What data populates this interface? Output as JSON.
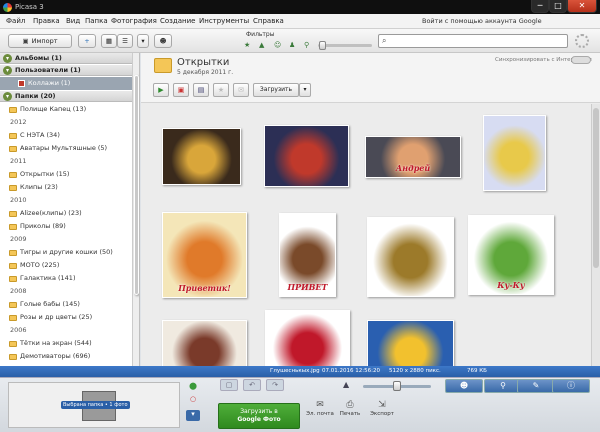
{
  "window": {
    "title": "Picasa 3"
  },
  "window_buttons": {
    "minimize": "─",
    "maximize": "□",
    "close": "✕"
  },
  "menu": {
    "items": [
      "Файл",
      "Правка",
      "Вид",
      "Папка",
      "Фотография",
      "Создание",
      "Инструменты",
      "Справка"
    ],
    "signin_link": "Войти с помощью аккаунта Google"
  },
  "toolbar": {
    "import_label": "Импорт",
    "import_icon": "camera-icon",
    "filters_label": "Фильтры",
    "filter_icons": [
      "star",
      "upload",
      "face",
      "people",
      "pin"
    ],
    "filter_glyphs": [
      "★",
      "▲",
      "☺",
      "♟",
      "⚲"
    ],
    "search_value": "",
    "search_glyph": "⌕",
    "album_glyph": "+",
    "view_thumb_glyph": "▦",
    "view_list_glyph": "☰",
    "dropdown_glyph": "▾",
    "people_glyph": "☻"
  },
  "sidebar": {
    "albums_header": "Альбомы (1)",
    "users_header": "Пользователи (1)",
    "collage_item": "Коллажи (1)",
    "folders_header": "Папки (20)",
    "toggle_glyph": "▾",
    "rows": [
      {
        "type": "folder",
        "label": "Полище Капец (13)"
      },
      {
        "type": "year",
        "label": "2012"
      },
      {
        "type": "folder",
        "label": "С НЭТА (34)"
      },
      {
        "type": "folder",
        "label": "Аватары Мультяшные (5)"
      },
      {
        "type": "year",
        "label": "2011"
      },
      {
        "type": "folder",
        "label": "Открытки (15)"
      },
      {
        "type": "folder",
        "label": "Клипы (23)"
      },
      {
        "type": "year",
        "label": "2010"
      },
      {
        "type": "folder",
        "label": "Alizee(клипы) (23)"
      },
      {
        "type": "folder",
        "label": "Приколы (89)"
      },
      {
        "type": "year",
        "label": "2009"
      },
      {
        "type": "folder",
        "label": "Тигры и другие кошки (50)"
      },
      {
        "type": "folder",
        "label": "МОТО (225)"
      },
      {
        "type": "folder",
        "label": "Галактика (141)"
      },
      {
        "type": "year",
        "label": "2008"
      },
      {
        "type": "folder",
        "label": "Голые бабы (145)"
      },
      {
        "type": "folder",
        "label": "Розы и др цветы (25)"
      },
      {
        "type": "year",
        "label": "2006"
      },
      {
        "type": "folder",
        "label": "Тётки на экран (544)"
      },
      {
        "type": "folder",
        "label": "Демотиваторы (696)"
      }
    ]
  },
  "folder": {
    "title": "Открытки",
    "date_prefix": "5",
    "date_month": "декабря",
    "date_year": "2011 г.",
    "sync_label": "Синхронизировать с Интернетом",
    "upload_label": "Загрузить",
    "upload_drop_glyph": "▾",
    "action_glyphs": [
      "▶",
      "▣",
      "▤",
      "★",
      "✉"
    ]
  },
  "thumbnails": [
    {
      "name": "thumb-smile-card",
      "bg": "#3a2a1c",
      "accent": "#d9a63a",
      "caption": ""
    },
    {
      "name": "thumb-city-night",
      "bg": "#2c2f55",
      "accent": "#c0392b",
      "caption": ""
    },
    {
      "name": "thumb-andrey",
      "bg": "#4a4a55",
      "accent": "#e0a070",
      "caption": "Андрей"
    },
    {
      "name": "thumb-flowers-bouquet",
      "bg": "#d7dcf2",
      "accent": "#e8c94a",
      "caption": ""
    },
    {
      "name": "thumb-privetik-bunny",
      "bg": "#f4e6b8",
      "accent": "#e07a2a",
      "caption": "Приветик!"
    },
    {
      "name": "thumb-privet-raccoon",
      "bg": "#ffffff",
      "accent": "#7a4a2a",
      "caption": "ПРИВЕТ"
    },
    {
      "name": "thumb-golden-toad",
      "bg": "#ffffff",
      "accent": "#9c7a2a",
      "caption": ""
    },
    {
      "name": "thumb-kuku-mouse",
      "bg": "#ffffff",
      "accent": "#5fa83a",
      "caption": "Ку-Ку"
    },
    {
      "name": "thumb-monkey",
      "bg": "#f0eae0",
      "accent": "#7a3a2a",
      "caption": ""
    },
    {
      "name": "thumb-red-roses",
      "bg": "#ffffff",
      "accent": "#c0182a",
      "caption": ""
    },
    {
      "name": "thumb-bee-card",
      "bg": "#2a5fb0",
      "accent": "#f2c12e",
      "caption": ""
    }
  ],
  "status": {
    "file": "Глушеснькых.jpg",
    "datetime": "07.01.2016 12:56:20",
    "dimensions": "5120 x 2880 пикс.",
    "size": "769 КБ"
  },
  "bottom": {
    "tray_label": "Выбрана папка • 1 фото",
    "gupload_line1": "Загрузить в",
    "gupload_line2": "Google Фото",
    "actions": [
      {
        "label": "Эл. почта",
        "glyph": "✉"
      },
      {
        "label": "Печать",
        "glyph": "⎙"
      },
      {
        "label": "Экспорт",
        "glyph": "⇲"
      }
    ],
    "tray_side_glyphs": [
      "⬤",
      "○",
      "▾"
    ],
    "right_icons": [
      "☻",
      "⚲",
      "✎",
      "ⓘ"
    ],
    "edit_glyphs": [
      "▢",
      "↶",
      "↷"
    ],
    "zoom_glyph": "▲"
  }
}
